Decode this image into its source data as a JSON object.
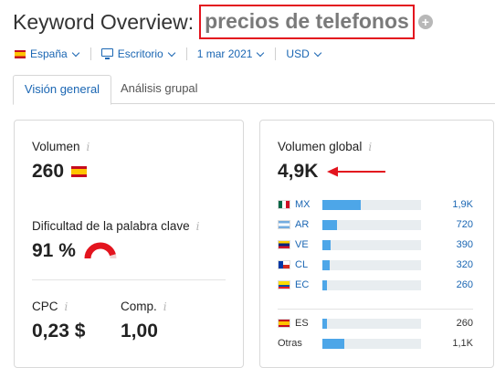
{
  "header": {
    "title": "Keyword Overview:",
    "keyword": "precios de telefonos",
    "add_icon": "+"
  },
  "filters": {
    "country": "España",
    "device": "Escritorio",
    "date": "1 mar 2021",
    "currency": "USD"
  },
  "tabs": [
    {
      "label": "Visión general",
      "active": true
    },
    {
      "label": "Análisis grupal",
      "active": false
    }
  ],
  "left_card": {
    "volume_label": "Volumen",
    "volume_value": "260",
    "difficulty_label": "Dificultad de la palabra clave",
    "difficulty_value": "91 %",
    "difficulty_percent": 91,
    "cpc_label": "CPC",
    "cpc_value": "0,23 $",
    "comp_label": "Comp.",
    "comp_value": "1,00",
    "info_icon": "i"
  },
  "right_card": {
    "global_label": "Volumen global",
    "global_value": "4,9K",
    "countries": [
      {
        "code": "MX",
        "value": "1,9K",
        "share": 0.39,
        "flag": "flag-mx"
      },
      {
        "code": "AR",
        "value": "720",
        "share": 0.15,
        "flag": "flag-ar"
      },
      {
        "code": "VE",
        "value": "390",
        "share": 0.08,
        "flag": "flag-ve"
      },
      {
        "code": "CL",
        "value": "320",
        "share": 0.07,
        "flag": "flag-cl"
      },
      {
        "code": "EC",
        "value": "260",
        "share": 0.05,
        "flag": "flag-ec"
      }
    ],
    "local": {
      "code": "ES",
      "value": "260",
      "share": 0.05,
      "flag": "flag-es"
    },
    "others": {
      "label": "Otras",
      "value": "1,1K",
      "share": 0.22
    }
  },
  "colors": {
    "accent_link": "#1a66b3",
    "highlight_box": "#e3141e",
    "bar_fill": "#4da6e8",
    "bar_track": "#e8edf0",
    "difficulty_gauge": "#e3141e",
    "arrow": "#e3141e"
  }
}
